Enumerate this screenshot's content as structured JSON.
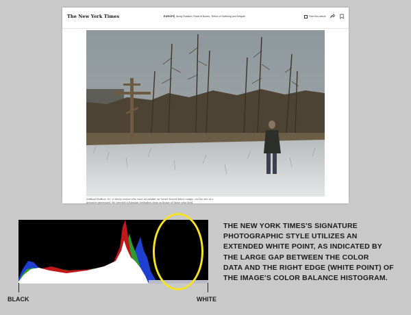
{
  "screenshot": {
    "logo": "The New York Times",
    "section": "EUROPE",
    "series": "Along Russia's 'Road of Bones,' Relics of Suffering and Despair",
    "share_button_label": "Give this article",
    "share_icon": "share-icon",
    "bookmark_icon": "bookmark-icon",
    "caption_line1": "Mikhail Shifirov, 63, a sheep owner who runs an exhibit on Soviet forced-labor camps, on the site of a",
    "caption_line2": "prisoner graveyard. He erected a Russian Orthodox cross in honor of those who died."
  },
  "histogram": {
    "left_label": "BLACK",
    "right_label": "WHITE",
    "highlight_color": "#f6e323",
    "channel_colors": {
      "red": "#c0191b",
      "green": "#2f9a2f",
      "blue": "#1f3fd0",
      "luminance": "#ffffff"
    }
  },
  "explanation": {
    "lines": [
      "THE NEW YORK TIMES'S SIGNATURE",
      "PHOTOGRAPHIC STYLE UTILIZES AN",
      "EXTENDED WHITE POINT, AS INDICATED BY",
      "THE LARGE GAP BETWEEN THE COLOR",
      "DATA AND THE RIGHT EDGE (WHITE POINT) OF",
      "THE IMAGE'S COLOR BALANCE HISTOGRAM."
    ]
  }
}
